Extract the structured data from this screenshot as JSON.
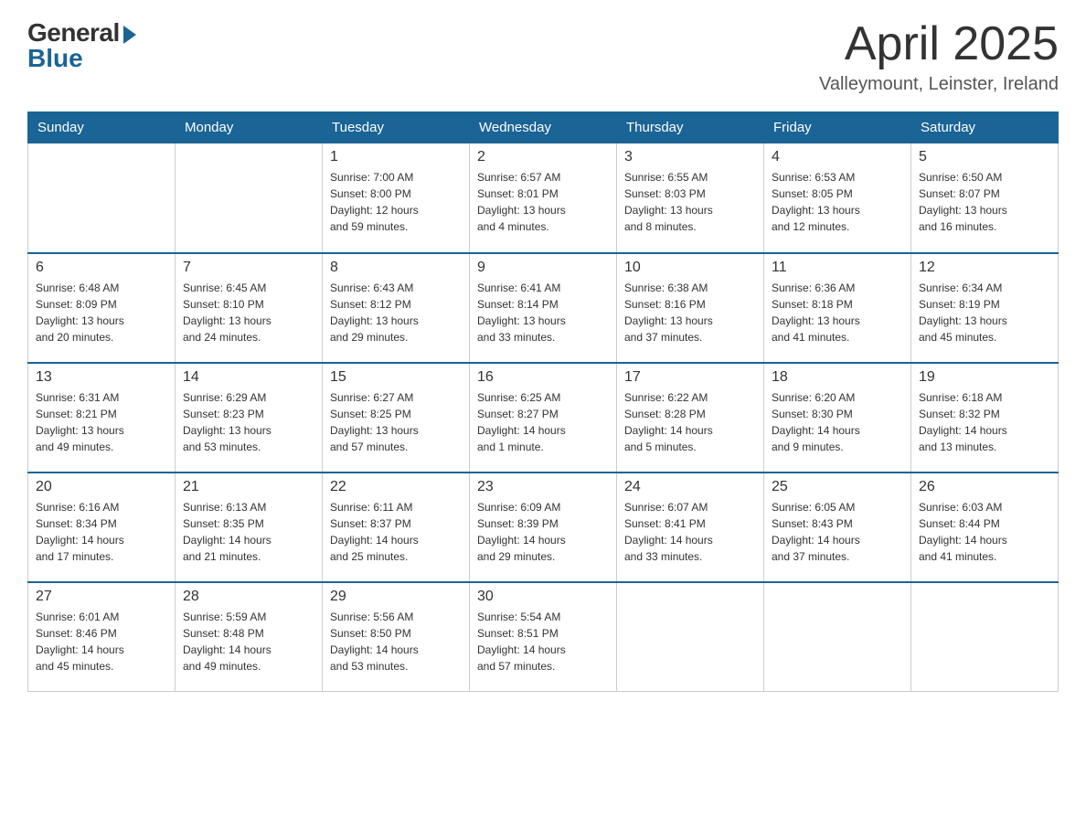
{
  "logo": {
    "general": "General",
    "blue": "Blue"
  },
  "title": "April 2025",
  "subtitle": "Valleymount, Leinster, Ireland",
  "weekdays": [
    "Sunday",
    "Monday",
    "Tuesday",
    "Wednesday",
    "Thursday",
    "Friday",
    "Saturday"
  ],
  "weeks": [
    [
      {
        "day": "",
        "info": ""
      },
      {
        "day": "",
        "info": ""
      },
      {
        "day": "1",
        "info": "Sunrise: 7:00 AM\nSunset: 8:00 PM\nDaylight: 12 hours\nand 59 minutes."
      },
      {
        "day": "2",
        "info": "Sunrise: 6:57 AM\nSunset: 8:01 PM\nDaylight: 13 hours\nand 4 minutes."
      },
      {
        "day": "3",
        "info": "Sunrise: 6:55 AM\nSunset: 8:03 PM\nDaylight: 13 hours\nand 8 minutes."
      },
      {
        "day": "4",
        "info": "Sunrise: 6:53 AM\nSunset: 8:05 PM\nDaylight: 13 hours\nand 12 minutes."
      },
      {
        "day": "5",
        "info": "Sunrise: 6:50 AM\nSunset: 8:07 PM\nDaylight: 13 hours\nand 16 minutes."
      }
    ],
    [
      {
        "day": "6",
        "info": "Sunrise: 6:48 AM\nSunset: 8:09 PM\nDaylight: 13 hours\nand 20 minutes."
      },
      {
        "day": "7",
        "info": "Sunrise: 6:45 AM\nSunset: 8:10 PM\nDaylight: 13 hours\nand 24 minutes."
      },
      {
        "day": "8",
        "info": "Sunrise: 6:43 AM\nSunset: 8:12 PM\nDaylight: 13 hours\nand 29 minutes."
      },
      {
        "day": "9",
        "info": "Sunrise: 6:41 AM\nSunset: 8:14 PM\nDaylight: 13 hours\nand 33 minutes."
      },
      {
        "day": "10",
        "info": "Sunrise: 6:38 AM\nSunset: 8:16 PM\nDaylight: 13 hours\nand 37 minutes."
      },
      {
        "day": "11",
        "info": "Sunrise: 6:36 AM\nSunset: 8:18 PM\nDaylight: 13 hours\nand 41 minutes."
      },
      {
        "day": "12",
        "info": "Sunrise: 6:34 AM\nSunset: 8:19 PM\nDaylight: 13 hours\nand 45 minutes."
      }
    ],
    [
      {
        "day": "13",
        "info": "Sunrise: 6:31 AM\nSunset: 8:21 PM\nDaylight: 13 hours\nand 49 minutes."
      },
      {
        "day": "14",
        "info": "Sunrise: 6:29 AM\nSunset: 8:23 PM\nDaylight: 13 hours\nand 53 minutes."
      },
      {
        "day": "15",
        "info": "Sunrise: 6:27 AM\nSunset: 8:25 PM\nDaylight: 13 hours\nand 57 minutes."
      },
      {
        "day": "16",
        "info": "Sunrise: 6:25 AM\nSunset: 8:27 PM\nDaylight: 14 hours\nand 1 minute."
      },
      {
        "day": "17",
        "info": "Sunrise: 6:22 AM\nSunset: 8:28 PM\nDaylight: 14 hours\nand 5 minutes."
      },
      {
        "day": "18",
        "info": "Sunrise: 6:20 AM\nSunset: 8:30 PM\nDaylight: 14 hours\nand 9 minutes."
      },
      {
        "day": "19",
        "info": "Sunrise: 6:18 AM\nSunset: 8:32 PM\nDaylight: 14 hours\nand 13 minutes."
      }
    ],
    [
      {
        "day": "20",
        "info": "Sunrise: 6:16 AM\nSunset: 8:34 PM\nDaylight: 14 hours\nand 17 minutes."
      },
      {
        "day": "21",
        "info": "Sunrise: 6:13 AM\nSunset: 8:35 PM\nDaylight: 14 hours\nand 21 minutes."
      },
      {
        "day": "22",
        "info": "Sunrise: 6:11 AM\nSunset: 8:37 PM\nDaylight: 14 hours\nand 25 minutes."
      },
      {
        "day": "23",
        "info": "Sunrise: 6:09 AM\nSunset: 8:39 PM\nDaylight: 14 hours\nand 29 minutes."
      },
      {
        "day": "24",
        "info": "Sunrise: 6:07 AM\nSunset: 8:41 PM\nDaylight: 14 hours\nand 33 minutes."
      },
      {
        "day": "25",
        "info": "Sunrise: 6:05 AM\nSunset: 8:43 PM\nDaylight: 14 hours\nand 37 minutes."
      },
      {
        "day": "26",
        "info": "Sunrise: 6:03 AM\nSunset: 8:44 PM\nDaylight: 14 hours\nand 41 minutes."
      }
    ],
    [
      {
        "day": "27",
        "info": "Sunrise: 6:01 AM\nSunset: 8:46 PM\nDaylight: 14 hours\nand 45 minutes."
      },
      {
        "day": "28",
        "info": "Sunrise: 5:59 AM\nSunset: 8:48 PM\nDaylight: 14 hours\nand 49 minutes."
      },
      {
        "day": "29",
        "info": "Sunrise: 5:56 AM\nSunset: 8:50 PM\nDaylight: 14 hours\nand 53 minutes."
      },
      {
        "day": "30",
        "info": "Sunrise: 5:54 AM\nSunset: 8:51 PM\nDaylight: 14 hours\nand 57 minutes."
      },
      {
        "day": "",
        "info": ""
      },
      {
        "day": "",
        "info": ""
      },
      {
        "day": "",
        "info": ""
      }
    ]
  ]
}
